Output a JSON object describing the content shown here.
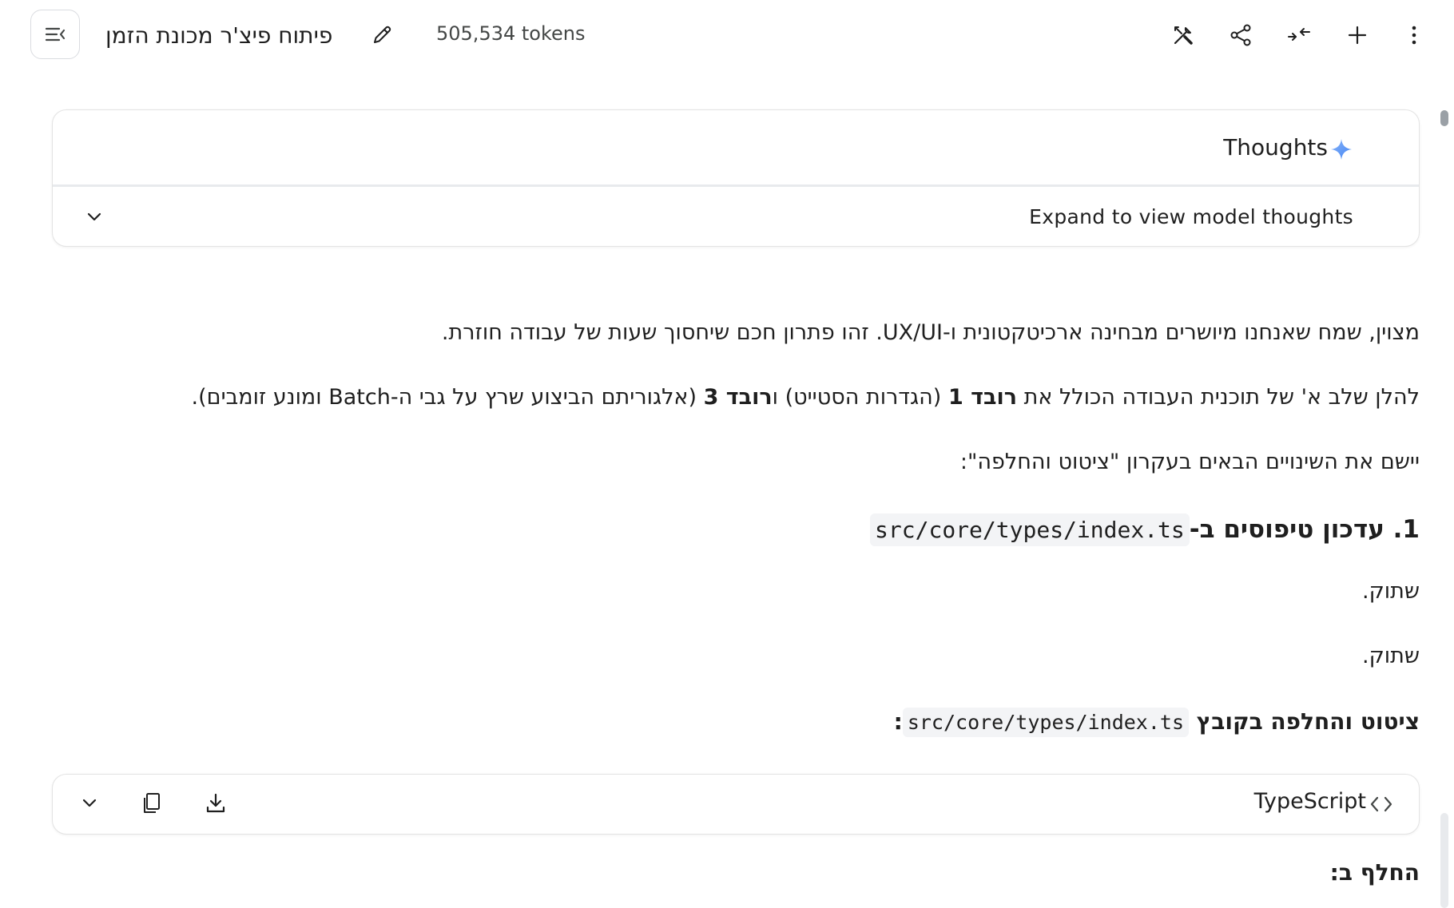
{
  "header": {
    "title": "פיתוח פיצ'ר מכונת הזמן",
    "tokens": "505,534 tokens",
    "icons": [
      "menu-collapse-icon",
      "edit-icon",
      "tools-icon",
      "share-icon",
      "compress-icon",
      "add-icon",
      "more-vert-icon"
    ]
  },
  "thoughts": {
    "title": "Thoughts",
    "expand_label": "Expand to view model thoughts"
  },
  "message": {
    "p1": "מצוין, שמח שאנחנו מיושרים מבחינה ארכיטקטונית ו-UX/UI. זהו פתרון חכם שיחסוך שעות של עבודה חוזרת.",
    "p2_a": "להלן שלב א' של תוכנית העבודה הכולל את ",
    "p2_b1": "רובד 1",
    "p2_c": " (הגדרות הסטייט) ו",
    "p2_b2": "רובד 3",
    "p2_d": " (אלגוריתם הביצוע שרץ על גבי ה-Batch ומונע זומבים).",
    "p3": "יישם את השינויים הבאים בעקרון \"ציטוט והחלפה\":",
    "h3_prefix": "1. עדכון טיפוסים ב-",
    "h3_code": "src/core/types/index.ts",
    "p4": "שתוק.",
    "p5": "שתוק.",
    "quote_prefix": "ציטוט והחלפה בקובץ ",
    "quote_code": "src/core/types/index.ts",
    "quote_suffix": ":",
    "replace_label": "החלף ב:"
  },
  "code_block": {
    "language": "TypeScript",
    "icons": [
      "code-icon",
      "download-icon",
      "copy-icon",
      "chevron-down-icon"
    ]
  }
}
